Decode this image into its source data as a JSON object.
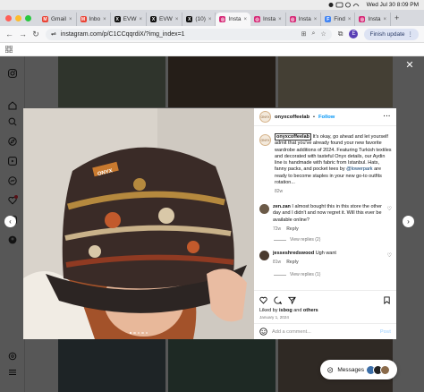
{
  "menubar": {
    "datetime": "Wed Jul 30  8:09 PM"
  },
  "browser": {
    "tabs": [
      {
        "label": "Gmail",
        "favicon": "gmail-icon"
      },
      {
        "label": "Inbo",
        "favicon": "gmail-icon"
      },
      {
        "label": "EVW",
        "favicon": "x-icon"
      },
      {
        "label": "EVW",
        "favicon": "x-icon"
      },
      {
        "label": "(10)",
        "favicon": "x-icon"
      },
      {
        "label": "Insta",
        "favicon": "instagram-icon",
        "active": true
      },
      {
        "label": "Insta",
        "favicon": "instagram-icon"
      },
      {
        "label": "Insta",
        "favicon": "instagram-icon"
      },
      {
        "label": "Find",
        "favicon": "find-icon"
      },
      {
        "label": "Insta",
        "favicon": "instagram-icon"
      }
    ],
    "url": "instagram.com/p/C1CCqqrdiX/?img_index=1",
    "profile_initial": "E",
    "finish_update_label": "Finish update"
  },
  "post": {
    "username": "onyxcoffeelab",
    "follow_label": "Follow",
    "caption_user": "onyxcoffeelab",
    "caption_part1": " It's okay, go ahead and let yourself admit that you've already found your new favorite wardrobe additions of 2024. Featuring Turkish textiles and decorated with tasteful Onyx details, our Aydin line is handmade with fabric from Istanbul. Hats, fanny packs, and pocket tees by ",
    "caption_mention": "@lowerpark",
    "caption_part2": " are ready to become staples in your new go-to outfits rotation...",
    "caption_age": "82w",
    "comments": [
      {
        "user": "zen.zan",
        "text": " I almost bought this in this store the other day and I didn't and now regret it. Will this ever be available online?",
        "age": "72w",
        "reply_label": "Reply",
        "view_replies": "View replies (2)"
      },
      {
        "user": "jesseshredswood",
        "text": " Ugh want",
        "age": "81w",
        "reply_label": "Reply",
        "view_replies": "View replies (1)"
      }
    ],
    "liked_by_prefix": "Liked by ",
    "liked_by_user": "isbog",
    "liked_by_suffix": " and ",
    "liked_by_others": "others",
    "date": "January 1, 2024",
    "add_comment_placeholder": "Add a comment...",
    "post_label": "Post",
    "image_alt": "Person wearing a patterned bucket hat with ONYX label",
    "hat_label": "ONYX"
  },
  "messages_label": "Messages",
  "colors": {
    "instagram_blue": "#0095f6",
    "overlay": "rgba(0,0,0,0.66)"
  }
}
